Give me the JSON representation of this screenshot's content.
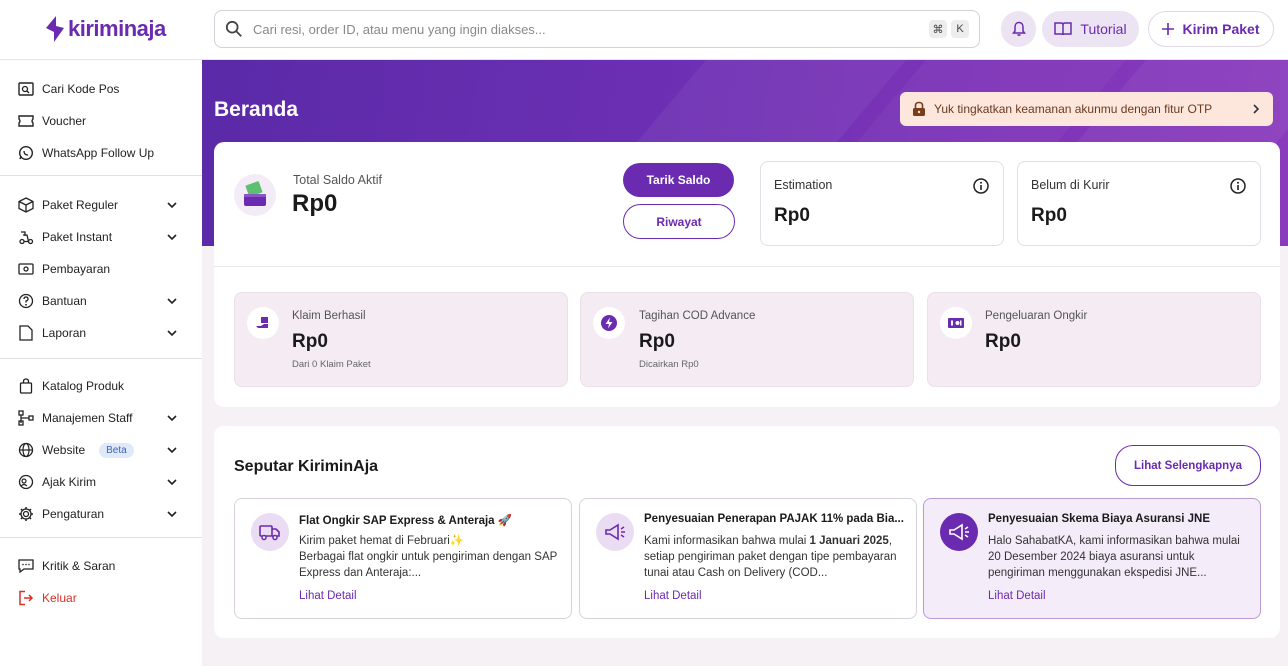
{
  "brand": {
    "name": "kiriminaja",
    "color": "#6a2bb0"
  },
  "search": {
    "placeholder": "Cari resi, order ID, atau menu yang ingin diakses...",
    "shortcut_mod": "⌘",
    "shortcut_key": "K"
  },
  "header": {
    "tutorial_label": "Tutorial",
    "kirim_label": "Kirim Paket"
  },
  "sidebar": {
    "group1": [
      {
        "label": "Cari Kode Pos",
        "icon": "search-zip-icon"
      },
      {
        "label": "Voucher",
        "icon": "ticket-icon"
      },
      {
        "label": "WhatsApp Follow Up",
        "icon": "whatsapp-icon"
      }
    ],
    "group2": [
      {
        "label": "Paket Reguler",
        "icon": "box-icon",
        "expandable": true
      },
      {
        "label": "Paket Instant",
        "icon": "courier-icon",
        "expandable": true
      },
      {
        "label": "Pembayaran",
        "icon": "payment-icon",
        "expandable": false
      },
      {
        "label": "Bantuan",
        "icon": "help-icon",
        "expandable": true
      },
      {
        "label": "Laporan",
        "icon": "report-icon",
        "expandable": true
      }
    ],
    "group3": [
      {
        "label": "Katalog Produk",
        "icon": "bag-icon",
        "expandable": false
      },
      {
        "label": "Manajemen Staff",
        "icon": "org-icon",
        "expandable": true
      },
      {
        "label": "Website",
        "icon": "globe-icon",
        "expandable": true,
        "badge": "Beta"
      },
      {
        "label": "Ajak Kirim",
        "icon": "referral-icon",
        "expandable": true
      },
      {
        "label": "Pengaturan",
        "icon": "gear-icon",
        "expandable": true
      }
    ],
    "group4": [
      {
        "label": "Kritik & Saran",
        "icon": "feedback-icon"
      },
      {
        "label": "Keluar",
        "icon": "logout-icon",
        "color": "#d93025"
      }
    ]
  },
  "page": {
    "title": "Beranda",
    "otp_notice": "Yuk tingkatkan keamanan akunmu dengan fitur OTP"
  },
  "saldo": {
    "label": "Total Saldo Aktif",
    "value": "Rp0",
    "withdraw_label": "Tarik Saldo",
    "history_label": "Riwayat",
    "estimation": {
      "label": "Estimation",
      "value": "Rp0"
    },
    "belum_kurir": {
      "label": "Belum di Kurir",
      "value": "Rp0"
    }
  },
  "stats": [
    {
      "label": "Klaim Berhasil",
      "value": "Rp0",
      "sub": "Dari 0 Klaim Paket",
      "icon": "claim-icon"
    },
    {
      "label": "Tagihan COD Advance",
      "value": "Rp0",
      "sub": "Dicairkan Rp0",
      "icon": "lightning-icon"
    },
    {
      "label": "Pengeluaran Ongkir",
      "value": "Rp0",
      "sub": "",
      "icon": "money-icon"
    }
  ],
  "news": {
    "title": "Seputar KiriminAja",
    "more_label": "Lihat Selengkapnya",
    "items": [
      {
        "title": "Flat Ongkir SAP Express & Anteraja 🚀",
        "line1": "Kirim paket hemat di Februari✨",
        "body": "Berbagai flat ongkir untuk pengiriman dengan SAP Express dan Anteraja:...",
        "link": "Lihat Detail",
        "icon": "delivery-truck-icon"
      },
      {
        "title": "Penyesuaian Penerapan PAJAK 11% pada Bia...",
        "body_pre": "Kami informasikan bahwa mulai ",
        "body_bold": "1 Januari 2025",
        "body_post": ", setiap pengiriman paket dengan tipe pembayaran tunai atau Cash on Delivery (COD...",
        "link": "Lihat Detail",
        "icon": "megaphone-icon"
      },
      {
        "title": "Penyesuaian Skema Biaya Asuransi JNE",
        "body": "Halo SahabatKA, kami informasikan bahwa mulai 20 Desember 2024 biaya asuransi untuk pengiriman menggunakan ekspedisi JNE...",
        "link": "Lihat Detail",
        "icon": "megaphone-icon"
      }
    ]
  }
}
